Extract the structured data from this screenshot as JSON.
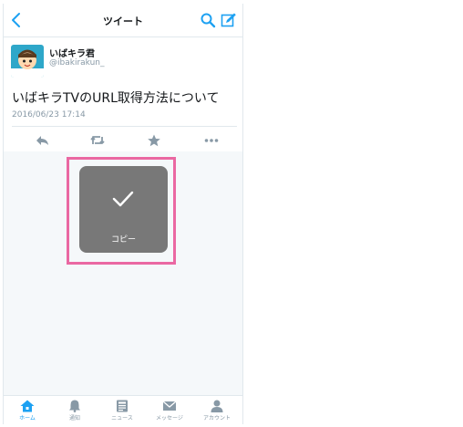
{
  "navbar": {
    "title": "ツイート",
    "back_icon": "chevron-left-icon",
    "search_icon": "search-icon",
    "compose_icon": "compose-icon"
  },
  "tweet": {
    "display_name": "いばキラ君",
    "handle": "@ibakirakun_",
    "text": "いばキラTVのURL取得方法について",
    "timestamp": "2016/06/23 17:14",
    "actions": [
      "reply-icon",
      "retweet-icon",
      "favorite-icon",
      "more-icon"
    ]
  },
  "toast": {
    "label": "コピー",
    "icon": "checkmark-icon"
  },
  "tabbar": {
    "tabs": [
      {
        "label": "ホーム",
        "icon": "home-icon",
        "active": true
      },
      {
        "label": "通知",
        "icon": "bell-icon",
        "active": false
      },
      {
        "label": "ニュース",
        "icon": "news-icon",
        "active": false
      },
      {
        "label": "メッセージ",
        "icon": "envelope-icon",
        "active": false
      },
      {
        "label": "アカウント",
        "icon": "person-icon",
        "active": false
      }
    ]
  },
  "colors": {
    "accent": "#1da1f2",
    "icon_gray": "#8899a6",
    "toast_bg": "#787878",
    "highlight": "#ea68a2"
  }
}
